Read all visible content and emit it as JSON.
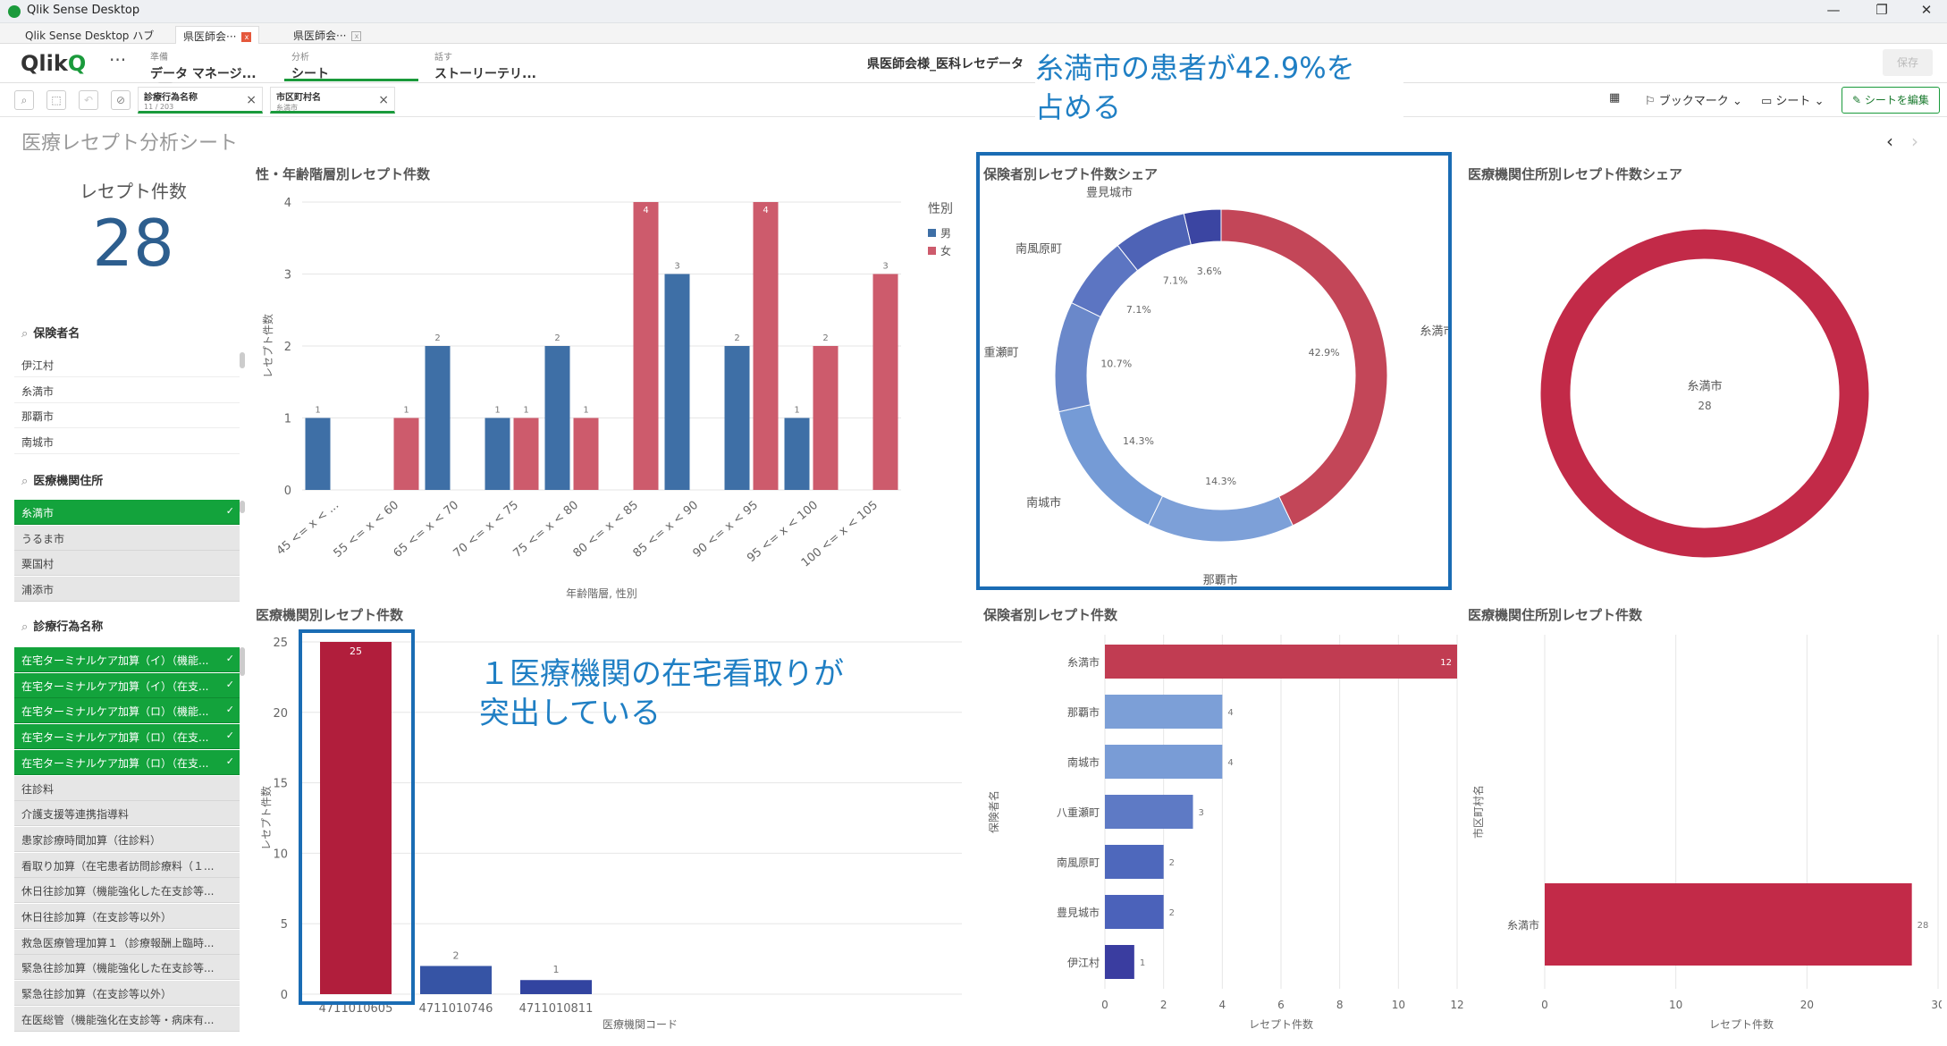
{
  "window": {
    "title": "Qlik Sense Desktop",
    "controls": [
      "—",
      "❐",
      "✕"
    ]
  },
  "tabs": [
    {
      "label": "Qlik Sense Desktop ハブ"
    },
    {
      "label": "県医師会···"
    },
    {
      "label": "県医師会···"
    }
  ],
  "nav": {
    "logo_text": "Qlik",
    "logo_q": "Q",
    "more": "···",
    "prepare": {
      "small": "準備",
      "label": "データ マネージ..."
    },
    "analyze": {
      "small": "分析",
      "label": "シート"
    },
    "narrate": {
      "small": "話す",
      "label": "ストーリーテリ..."
    },
    "app_title": "県医師会様_医科レセデータ",
    "save": "保存"
  },
  "selections": [
    {
      "field": "診療行為名称",
      "value": "11 / 203"
    },
    {
      "field": "市区町村名",
      "value": "糸満市"
    }
  ],
  "toolbar": {
    "bookmark": "ブックマーク",
    "sheet": "シート",
    "edit": "シートを編集"
  },
  "callouts": {
    "donut": [
      "糸満市の患者が42.9%を",
      "占める"
    ],
    "bar": [
      "１医療機関の在宅看取りが",
      "突出している"
    ]
  },
  "sheet": {
    "title": "医療レセプト分析シート"
  },
  "kpi": {
    "label": "レセプト件数",
    "value": "28"
  },
  "listbox_insurer": {
    "title": "保険者名",
    "items": [
      "伊江村",
      "糸満市",
      "那覇市",
      "南城市"
    ]
  },
  "listbox_address": {
    "title": "医療機関住所",
    "items": [
      {
        "label": "糸満市",
        "state": "selected"
      },
      {
        "label": "うるま市",
        "state": "alt"
      },
      {
        "label": "粟国村",
        "state": "alt"
      },
      {
        "label": "浦添市",
        "state": "alt"
      }
    ]
  },
  "listbox_procedure": {
    "title": "診療行為名称",
    "items": [
      {
        "label": "在宅ターミナルケア加算（イ）（機能...",
        "state": "selected"
      },
      {
        "label": "在宅ターミナルケア加算（イ）（在支...",
        "state": "selected"
      },
      {
        "label": "在宅ターミナルケア加算（ロ）（機能...",
        "state": "selected"
      },
      {
        "label": "在宅ターミナルケア加算（ロ）（在支...",
        "state": "selected"
      },
      {
        "label": "在宅ターミナルケア加算（ロ）（在支...",
        "state": "selected"
      },
      {
        "label": "往診料",
        "state": "alt"
      },
      {
        "label": "介護支援等連携指導料",
        "state": "alt"
      },
      {
        "label": "患家診療時間加算（往診料）",
        "state": "alt"
      },
      {
        "label": "看取り加算（在宅患者訪問診療料（１...",
        "state": "alt"
      },
      {
        "label": "休日往診加算（機能強化した在支診等...",
        "state": "alt"
      },
      {
        "label": "休日往診加算（在支診等以外）",
        "state": "alt"
      },
      {
        "label": "救急医療管理加算１（診療報酬上臨時...",
        "state": "alt"
      },
      {
        "label": "緊急往診加算（機能強化した在支診等...",
        "state": "alt"
      },
      {
        "label": "緊急往診加算（在支診等以外）",
        "state": "alt"
      },
      {
        "label": "在医総管（機能強化在支診等・病床有...",
        "state": "alt"
      }
    ]
  },
  "chart_data": [
    {
      "type": "bar",
      "title": "性・年齢階層別レセプト件数",
      "xlabel": "年齢階層, 性別",
      "ylabel": "レセプト件数",
      "ylim": [
        0,
        4
      ],
      "categories": [
        "45 <= x < ...",
        "55 <= x < 60",
        "65 <= x < 70",
        "70 <= x < 75",
        "75 <= x < 80",
        "80 <= x < 85",
        "85 <= x < 90",
        "90 <= x < 95",
        "95 <= x < 100",
        "100 <= x < 105"
      ],
      "legend_title": "性別",
      "series": [
        {
          "name": "男",
          "color": "#3e6fa6",
          "values": [
            1,
            null,
            2,
            1,
            2,
            null,
            3,
            2,
            1,
            null
          ]
        },
        {
          "name": "女",
          "color": "#cd5b6c",
          "values": [
            null,
            1,
            null,
            1,
            1,
            4,
            null,
            4,
            2,
            3
          ]
        }
      ]
    },
    {
      "type": "pie",
      "title": "保険者別レセプト件数シェア",
      "labels": [
        "糸満市",
        "那覇市",
        "南城市",
        "八重瀬町",
        "南風原町",
        "豊見城市",
        "伊江村"
      ],
      "values": [
        42.9,
        14.3,
        14.3,
        10.7,
        7.1,
        7.1,
        3.6
      ],
      "pct_labels": [
        "42.9%",
        "14.3%",
        "14.3%",
        "10.7%",
        "7.1%",
        "7.1%",
        "3.6%"
      ],
      "colors": [
        "#c34658",
        "#7da0d8",
        "#759bd6",
        "#6a88ca",
        "#5c75c2",
        "#4e63b6",
        "#3b45a2"
      ]
    },
    {
      "type": "pie",
      "title": "医療機関住所別レセプト件数シェア",
      "labels": [
        "糸満市"
      ],
      "values": [
        28
      ],
      "value_labels": [
        "28"
      ],
      "colors": [
        "#c22a48"
      ]
    },
    {
      "type": "bar",
      "title": "医療機関別レセプト件数",
      "xlabel": "医療機関コード",
      "ylabel": "レセプト件数",
      "ylim": [
        0,
        25
      ],
      "categories": [
        "4711010605",
        "4711010746",
        "4711010811"
      ],
      "values": [
        25,
        2,
        1
      ],
      "colors": [
        "#b11e3c",
        "#3654a5",
        "#3244a0"
      ]
    },
    {
      "type": "bar",
      "orientation": "horizontal",
      "title": "保険者別レセプト件数",
      "xlabel": "レセプト件数",
      "ylabel": "保険者名",
      "xlim": [
        0,
        12
      ],
      "categories": [
        "糸満市",
        "那覇市",
        "南城市",
        "八重瀬町",
        "南風原町",
        "豊見城市",
        "伊江村"
      ],
      "values": [
        12,
        4,
        4,
        3,
        2,
        2,
        1
      ],
      "colors": [
        "#c13c52",
        "#7c9fd7",
        "#799cd6",
        "#5e7ac5",
        "#4e68bc",
        "#4b62ba",
        "#3a3da0"
      ]
    },
    {
      "type": "bar",
      "orientation": "horizontal",
      "title": "医療機関住所別レセプト件数",
      "xlabel": "レセプト件数",
      "ylabel": "市区町村名",
      "xlim": [
        0,
        30
      ],
      "categories": [
        "糸満市"
      ],
      "values": [
        28
      ],
      "colors": [
        "#c22a48"
      ]
    }
  ]
}
